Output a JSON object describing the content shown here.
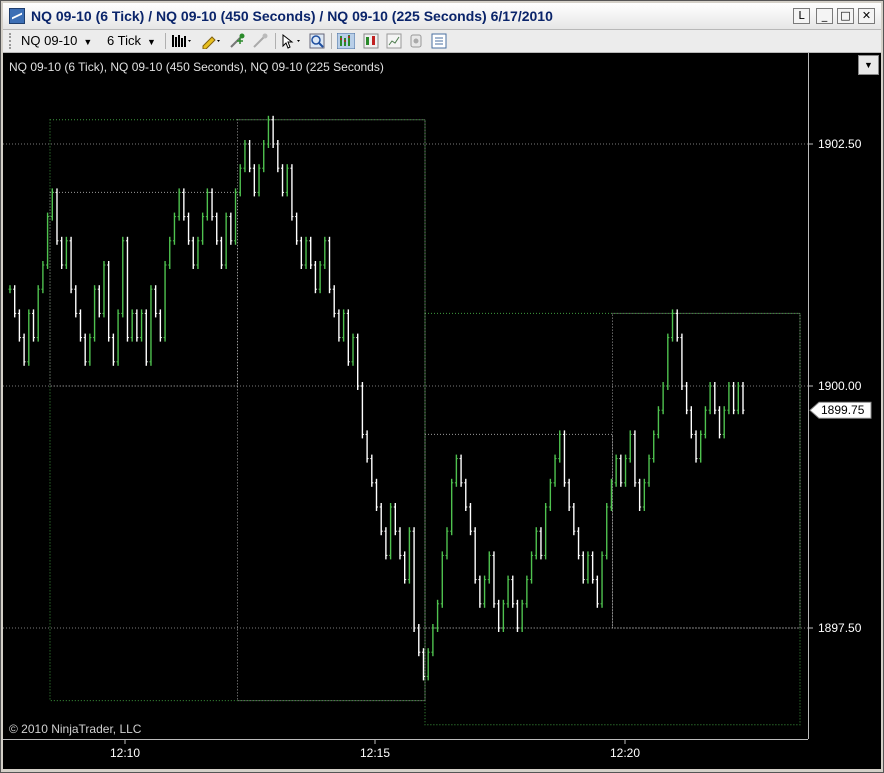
{
  "window": {
    "title": "NQ 09-10 (6 Tick) / NQ 09-10 (450 Seconds) / NQ 09-10 (225 Seconds)  6/17/2010",
    "minimize_label": "_",
    "restore_label": "□",
    "close_label": "✕",
    "extra_label": "L"
  },
  "toolbar": {
    "instrument": "NQ 09-10",
    "interval": "6 Tick",
    "icons": [
      "bar-style-icon",
      "pencil-icon",
      "crosshair-icon",
      "arrow-icon",
      "pointer-icon",
      "zoom-icon",
      "chart-type-icon",
      "candlestick-icon",
      "indicator-icon",
      "strategy-icon",
      "properties-icon"
    ]
  },
  "chart": {
    "series_label": "NQ 09-10 (6 Tick), NQ 09-10 (450 Seconds), NQ 09-10 (225 Seconds)",
    "copyright": "© 2010 NinjaTrader, LLC",
    "last_price": "1899.75",
    "colors": {
      "background": "#000000",
      "up_bar": "#4fc24f",
      "down_bar": "#ffffff",
      "grid": "#7a7a7a",
      "box_green": "#3e9b3e",
      "box_gray": "#9a9a9a",
      "axis_text": "#ffffff"
    }
  },
  "chart_data": {
    "type": "bar",
    "title": "",
    "xlabel": "",
    "ylabel": "",
    "ylim": [
      1896.25,
      1903.5
    ],
    "y_ticks": [
      "1902.50",
      "1900.00",
      "1897.50"
    ],
    "x_ticks": [
      "12:10",
      "12:15",
      "12:20"
    ],
    "last_price": 1899.75,
    "boxes_450s": [
      {
        "start": "12:08:30",
        "end": "12:16:00",
        "high": 1902.75,
        "low": 1896.75
      },
      {
        "start": "12:16:00",
        "end": "12:23:30",
        "high": 1900.75,
        "low": 1896.5
      }
    ],
    "boxes_225s": [
      {
        "start": "12:08:30",
        "end": "12:12:15",
        "high": 1902.0,
        "low": 1900.0
      },
      {
        "start": "12:12:15",
        "end": "12:16:00",
        "high": 1902.75,
        "low": 1896.75
      },
      {
        "start": "12:16:00",
        "end": "12:19:45",
        "high": 1899.5,
        "low": 1897.5
      },
      {
        "start": "12:19:45",
        "end": "12:23:30",
        "high": 1900.75,
        "low": 1897.5
      }
    ],
    "tick_bars_path": [
      1901.0,
      1900.75,
      1900.5,
      1900.25,
      1900.75,
      1900.5,
      1901.0,
      1901.25,
      1901.75,
      1902.0,
      1901.5,
      1901.25,
      1901.5,
      1901.0,
      1900.75,
      1900.5,
      1900.25,
      1900.5,
      1901.0,
      1900.75,
      1901.25,
      1900.5,
      1900.25,
      1900.75,
      1901.5,
      1900.5,
      1900.75,
      1900.5,
      1900.75,
      1900.25,
      1901.0,
      1900.75,
      1900.5,
      1901.25,
      1901.5,
      1901.75,
      1902.0,
      1901.75,
      1901.5,
      1901.25,
      1901.5,
      1901.75,
      1902.0,
      1901.75,
      1901.5,
      1901.25,
      1901.75,
      1901.5,
      1902.0,
      1902.25,
      1902.5,
      1902.25,
      1902.0,
      1902.25,
      1902.5,
      1902.75,
      1902.5,
      1902.25,
      1902.0,
      1902.25,
      1901.75,
      1901.5,
      1901.25,
      1901.5,
      1901.25,
      1901.0,
      1901.25,
      1901.5,
      1901.0,
      1900.75,
      1900.5,
      1900.75,
      1900.25,
      1900.5,
      1900.0,
      1899.5,
      1899.25,
      1899.0,
      1898.75,
      1898.5,
      1898.25,
      1898.75,
      1898.5,
      1898.25,
      1898.0,
      1898.5,
      1897.5,
      1897.25,
      1897.0,
      1897.25,
      1897.5,
      1897.75,
      1898.25,
      1898.5,
      1899.0,
      1899.25,
      1899.0,
      1898.75,
      1898.5,
      1898.0,
      1897.75,
      1898.0,
      1898.25,
      1897.75,
      1897.5,
      1897.75,
      1898.0,
      1897.75,
      1897.5,
      1897.75,
      1898.0,
      1898.25,
      1898.5,
      1898.25,
      1898.75,
      1899.0,
      1899.25,
      1899.5,
      1899.0,
      1898.75,
      1898.5,
      1898.25,
      1898.0,
      1898.25,
      1898.0,
      1897.75,
      1898.25,
      1898.75,
      1899.0,
      1899.25,
      1899.0,
      1899.25,
      1899.5,
      1899.0,
      1898.75,
      1899.0,
      1899.25,
      1899.5,
      1899.75,
      1900.0,
      1900.5,
      1900.75,
      1900.5,
      1900.0,
      1899.75,
      1899.5,
      1899.25,
      1899.5,
      1899.75,
      1900.0,
      1899.75,
      1899.5,
      1899.75,
      1900.0,
      1899.75,
      1900.0,
      1899.75
    ]
  }
}
